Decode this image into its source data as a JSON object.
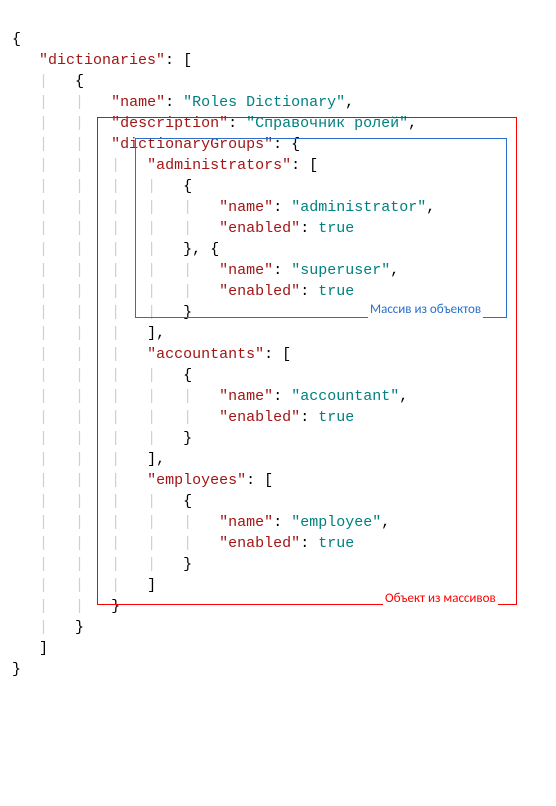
{
  "colors": {
    "key": "#a31515",
    "string": "#008080",
    "boolean": "#008080",
    "guide": "#d0d0d0",
    "red_box": "#ff0000",
    "blue_box": "#2a6fc9"
  },
  "annotations": {
    "blue_label": "Массив из объектов",
    "red_label": "Объект из массивов"
  },
  "json_dump": {
    "dictionaries": [
      {
        "name": "Roles Dictionary",
        "description": "Справочник ролей",
        "dictionaryGroups": {
          "administrators": [
            {
              "name": "administrator",
              "enabled": true
            },
            {
              "name": "superuser",
              "enabled": true
            }
          ],
          "accountants": [
            {
              "name": "accountant",
              "enabled": true
            }
          ],
          "employees": [
            {
              "name": "employee",
              "enabled": true
            }
          ]
        }
      }
    ]
  },
  "tokens": {
    "k_dictionaries": "\"dictionaries\"",
    "k_name": "\"name\"",
    "k_description": "\"description\"",
    "k_dictionaryGroups": "\"dictionaryGroups\"",
    "k_administrators": "\"administrators\"",
    "k_enabled": "\"enabled\"",
    "k_accountants": "\"accountants\"",
    "k_employees": "\"employees\"",
    "v_roles_dict": "\"Roles Dictionary\"",
    "v_desc": "\"Справочник ролей\"",
    "v_administrator": "\"administrator\"",
    "v_superuser": "\"superuser\"",
    "v_accountant": "\"accountant\"",
    "v_employee": "\"employee\"",
    "v_true": "true"
  }
}
